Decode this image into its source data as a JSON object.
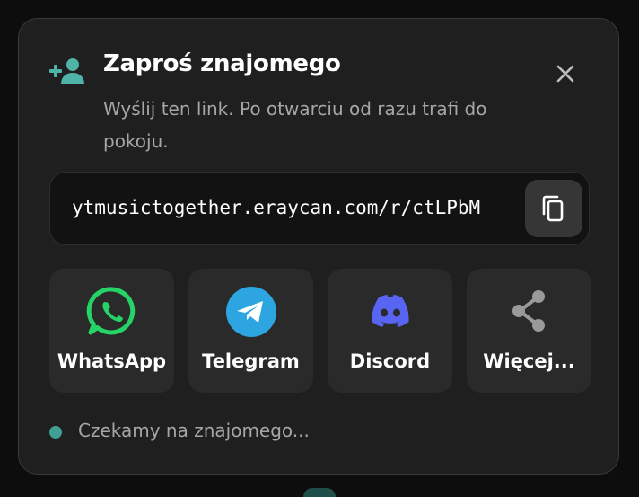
{
  "dialog": {
    "title": "Zaproś znajomego",
    "subtitle": "Wyślij ten link. Po otwarciu od razu trafi do pokoju.",
    "icon": "add-user-icon",
    "close_icon": "close-icon"
  },
  "link": {
    "url": "ytmusictogether.eraycan.com/r/ctLPbM",
    "copy_icon": "copy-icon"
  },
  "share_options": [
    {
      "label": "WhatsApp",
      "icon": "whatsapp-icon",
      "color": "#25d366"
    },
    {
      "label": "Telegram",
      "icon": "telegram-icon",
      "color": "#2ca5e0"
    },
    {
      "label": "Discord",
      "icon": "discord-icon",
      "color": "#5865f2"
    },
    {
      "label": "Więcej...",
      "icon": "share-icon",
      "color": "#9a9a9a"
    }
  ],
  "status": {
    "text": "Czekamy na znajomego...",
    "color": "#3f9f94"
  },
  "colors": {
    "accent": "#4fb3a8",
    "background": "#1f1f1f",
    "surface": "#2a2a2a"
  }
}
